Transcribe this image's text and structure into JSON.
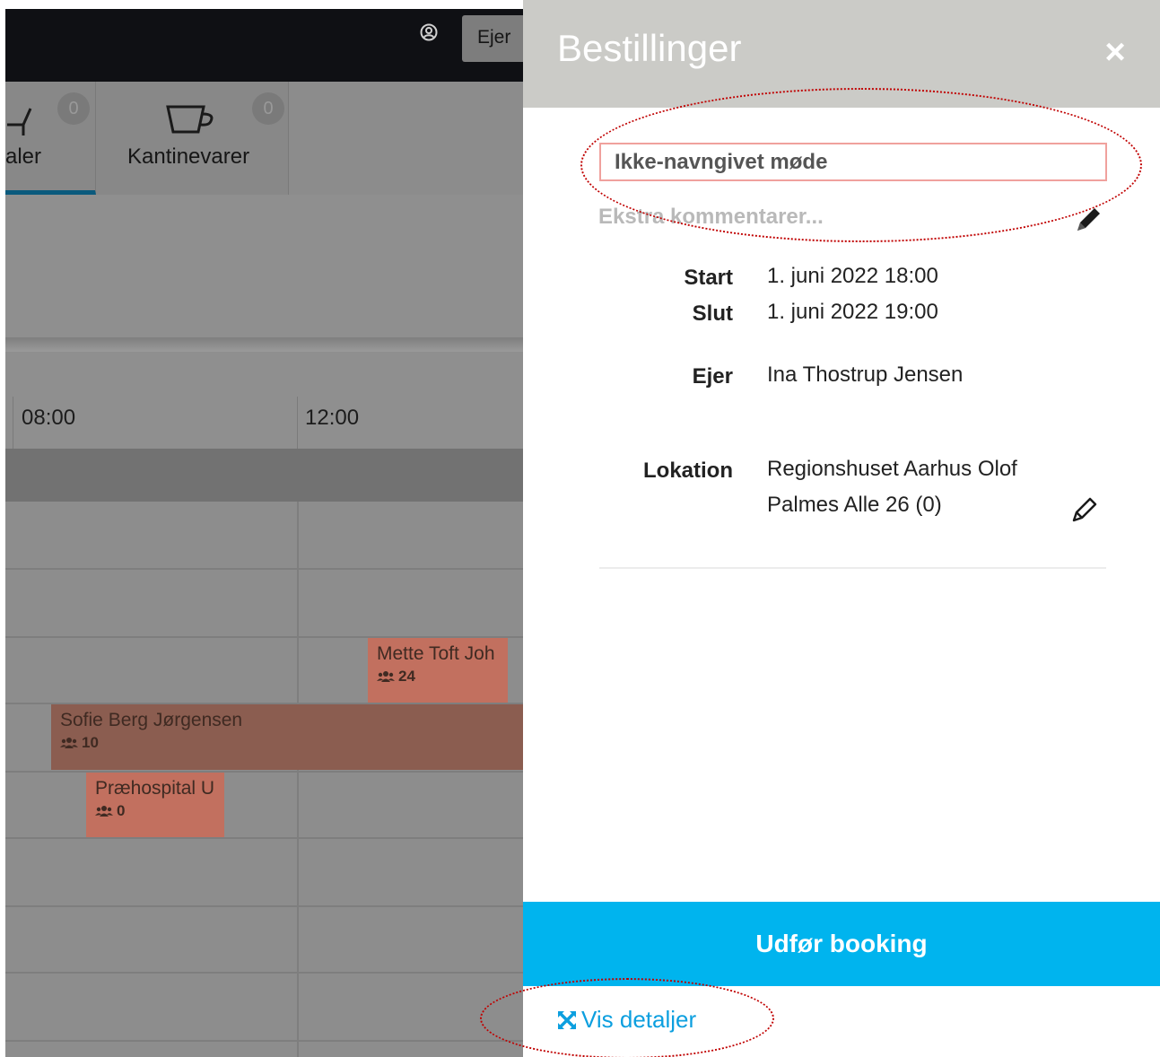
{
  "background": {
    "owner_button": "Ejer",
    "tabs": [
      {
        "label": "aler",
        "badge": "0"
      },
      {
        "label": "Kantinevarer",
        "badge": "0"
      }
    ],
    "timeline": [
      "08:00",
      "12:00"
    ],
    "events": [
      {
        "name": "Mette Toft Joh",
        "count": "24"
      },
      {
        "name": "Sofie Berg Jørgensen",
        "count": "10"
      },
      {
        "name": "Præhospital U",
        "count": "0"
      }
    ]
  },
  "drawer": {
    "title": "Bestillinger",
    "close_label": "×",
    "name_value": "Ikke-navngivet møde",
    "comments_placeholder": "Ekstra kommentarer...",
    "start_label": "Start",
    "start_value": "1. juni 2022 18:00",
    "end_label": "Slut",
    "end_value": "1. juni 2022 19:00",
    "owner_label": "Ejer",
    "owner_value": "Ina Thostrup Jensen",
    "location_label": "Lokation",
    "location_line1": "Regionshuset Aarhus Olof",
    "location_line2": "Palmes Alle 26 (0)",
    "book_button": "Udfør booking",
    "details_link": "Vis detaljer"
  },
  "colors": {
    "accent": "#00b4ee",
    "link": "#0c9fdf",
    "header": "#cbcbc7",
    "event": "#c2705f",
    "annotation": "#c00000"
  }
}
